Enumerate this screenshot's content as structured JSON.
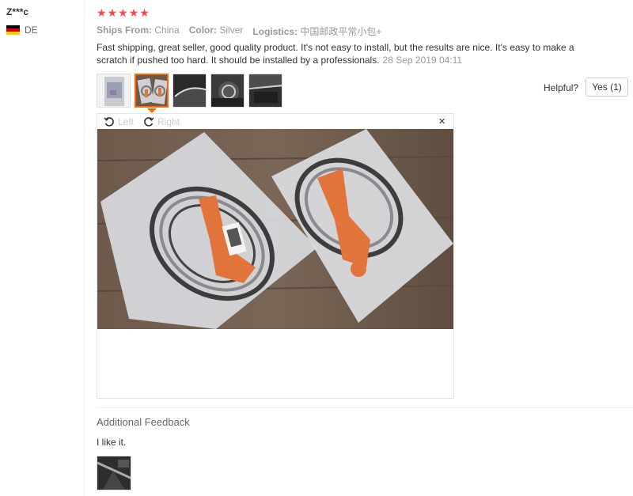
{
  "reviewer": {
    "name": "Z***c",
    "country": "DE",
    "flag_icon": "germany-flag-icon"
  },
  "rating": {
    "stars": 5,
    "max": 5,
    "color": "#ff4747"
  },
  "attributes": [
    {
      "name": "Ships From:",
      "value": "China"
    },
    {
      "name": "Color:",
      "value": "Silver"
    },
    {
      "name": "Logistics:",
      "value": "中国邮政平常小包+"
    }
  ],
  "review": {
    "text": "Fast shipping, great seller, good quality product. It's not easy to install, but the results are nice. It's easy to make a scratch if pushed too hard. It should be installed by a professionals.",
    "date": "28 Sep 2019 04:11"
  },
  "helpful": {
    "label": "Helpful?",
    "yes_label": "Yes (1)"
  },
  "viewer": {
    "rotate_left": "Left",
    "rotate_right": "Right",
    "close": "×",
    "active_thumb_index": 1
  },
  "additional_feedback": {
    "title": "Additional Feedback",
    "text": "I like it."
  },
  "colors": {
    "accent": "#ff6600",
    "star": "#ff4747"
  }
}
